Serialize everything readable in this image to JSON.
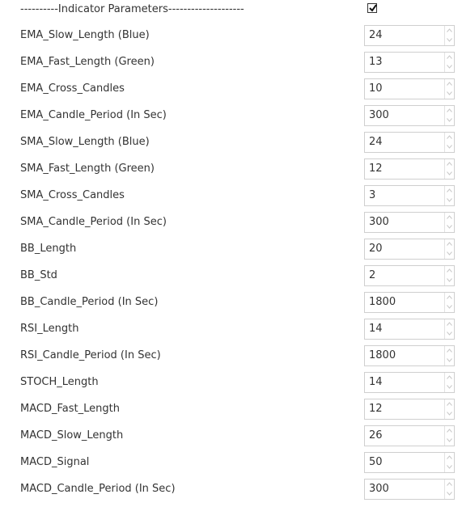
{
  "header": {
    "label": "----------Indicator Parameters--------------------",
    "checked": true
  },
  "params": [
    {
      "label": "EMA_Slow_Length (Blue)",
      "value": "24"
    },
    {
      "label": "EMA_Fast_Length (Green)",
      "value": "13"
    },
    {
      "label": "EMA_Cross_Candles",
      "value": "10"
    },
    {
      "label": "EMA_Candle_Period (In Sec)",
      "value": "300"
    },
    {
      "label": "SMA_Slow_Length (Blue)",
      "value": "24"
    },
    {
      "label": "SMA_Fast_Length (Green)",
      "value": "12"
    },
    {
      "label": "SMA_Cross_Candles",
      "value": "3"
    },
    {
      "label": "SMA_Candle_Period (In Sec)",
      "value": "300"
    },
    {
      "label": "BB_Length",
      "value": "20"
    },
    {
      "label": "BB_Std",
      "value": "2"
    },
    {
      "label": "BB_Candle_Period (In Sec)",
      "value": "1800"
    },
    {
      "label": "RSI_Length",
      "value": "14"
    },
    {
      "label": "RSI_Candle_Period (In Sec)",
      "value": "1800"
    },
    {
      "label": "STOCH_Length",
      "value": "14"
    },
    {
      "label": "MACD_Fast_Length",
      "value": "12"
    },
    {
      "label": "MACD_Slow_Length",
      "value": "26"
    },
    {
      "label": "MACD_Signal",
      "value": "50"
    },
    {
      "label": "MACD_Candle_Period (In Sec)",
      "value": "300"
    }
  ]
}
